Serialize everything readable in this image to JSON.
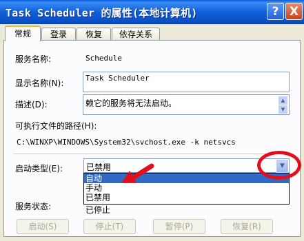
{
  "window": {
    "title": "Task Scheduler 的属性(本地计算机)",
    "help_label": "?",
    "close_label": "X"
  },
  "tabs": [
    {
      "label": "常规"
    },
    {
      "label": "登录"
    },
    {
      "label": "恢复"
    },
    {
      "label": "依存关系"
    }
  ],
  "general": {
    "service_name_label": "服务名称:",
    "service_name_value": "Schedule",
    "display_name_label": "显示名称(N):",
    "display_name_value": "Task Scheduler",
    "description_label": "描述(D):",
    "description_value": "赖它的服务将无法启动。",
    "exe_path_label": "可执行文件的路径(H):",
    "exe_path_value": "C:\\WINXP\\WINDOWS\\System32\\svchost.exe -k netsvcs",
    "startup_type_label": "启动类型(E):",
    "startup_type_value": "已禁用",
    "startup_options": [
      "自动",
      "手动",
      "已禁用"
    ],
    "service_status_label": "服务状态:",
    "service_status_value": "已停止"
  },
  "buttons": {
    "start": "启动(S)",
    "stop": "停止(T)",
    "pause": "暂停(P)",
    "resume": "恢复(R)"
  },
  "colors": {
    "title_bar": "#0a5ee0",
    "annotation": "#e2101f",
    "selection": "#316ac5"
  }
}
